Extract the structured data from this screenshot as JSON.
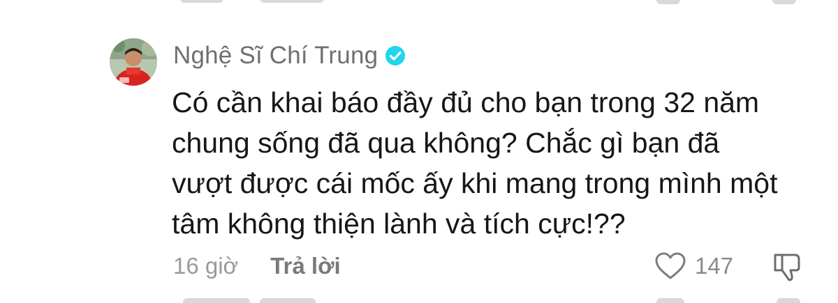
{
  "comment": {
    "author": {
      "name": "Nghệ Sĩ Chí Trung",
      "verified": true,
      "avatar_icon": "avatar-photo"
    },
    "text": "Có cần khai báo đầy đủ cho bạn trong 32 năm\nchung sống đã qua không? Chắc gì bạn đã\nvượt được cái mốc ấy khi mang trong mình một\ntâm không thiện lành và tích cực!??",
    "timestamp": "16 giờ",
    "reply_label": "Trả lời",
    "like_count": "147",
    "like_icon": "heart-outline-icon",
    "dislike_icon": "thumbs-down-outline-icon"
  },
  "colors": {
    "verified_badge": "#20d5ec",
    "author_name": "#6f6f6f",
    "text": "#161616",
    "meta": "#9a9a9a"
  }
}
